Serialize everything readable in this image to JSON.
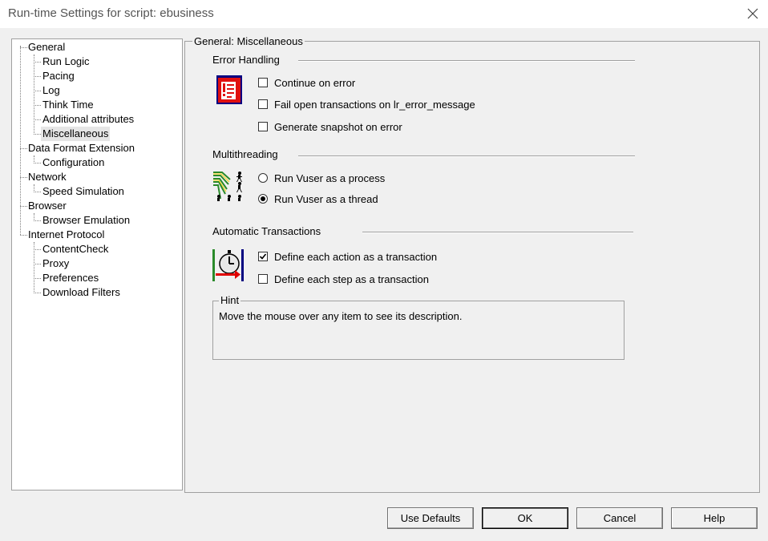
{
  "window": {
    "title": "Run-time Settings for script: ebusiness"
  },
  "tree": {
    "nodes": [
      {
        "label": "General"
      },
      {
        "label": "Run Logic"
      },
      {
        "label": "Pacing"
      },
      {
        "label": "Log"
      },
      {
        "label": "Think Time"
      },
      {
        "label": "Additional attributes"
      },
      {
        "label": "Miscellaneous"
      },
      {
        "label": "Data Format Extension"
      },
      {
        "label": "Configuration"
      },
      {
        "label": "Network"
      },
      {
        "label": "Speed Simulation"
      },
      {
        "label": "Browser"
      },
      {
        "label": "Browser Emulation"
      },
      {
        "label": "Internet Protocol"
      },
      {
        "label": "ContentCheck"
      },
      {
        "label": "Proxy"
      },
      {
        "label": "Preferences"
      },
      {
        "label": "Download Filters"
      }
    ],
    "selected": "Miscellaneous"
  },
  "panel": {
    "title": "General: Miscellaneous",
    "error_handling": {
      "label": "Error Handling",
      "icon": "error-icon",
      "options": [
        {
          "label": "Continue on error",
          "checked": false
        },
        {
          "label": "Fail open transactions on lr_error_message",
          "checked": false
        },
        {
          "label": "Generate snapshot on error",
          "checked": false
        }
      ]
    },
    "multithreading": {
      "label": "Multithreading",
      "icon": "multithreading-icon",
      "options": [
        {
          "label": "Run Vuser as a process",
          "selected": false
        },
        {
          "label": "Run Vuser as a thread",
          "selected": true
        }
      ]
    },
    "automatic_transactions": {
      "label": "Automatic Transactions",
      "icon": "stopwatch-icon",
      "options": [
        {
          "label": "Define each action as a transaction",
          "checked": true
        },
        {
          "label": "Define each step as a transaction",
          "checked": false
        }
      ]
    },
    "hint": {
      "label": "Hint",
      "text": "Move the mouse over any item to see its description."
    }
  },
  "buttons": {
    "use_defaults": "Use Defaults",
    "ok": "OK",
    "cancel": "Cancel",
    "help": "Help"
  },
  "colors": {
    "window_bg": "#f0f0f0",
    "error_icon_red": "#e01010",
    "icon_green": "#2a8a2a",
    "arrow_red": "#e00000"
  }
}
